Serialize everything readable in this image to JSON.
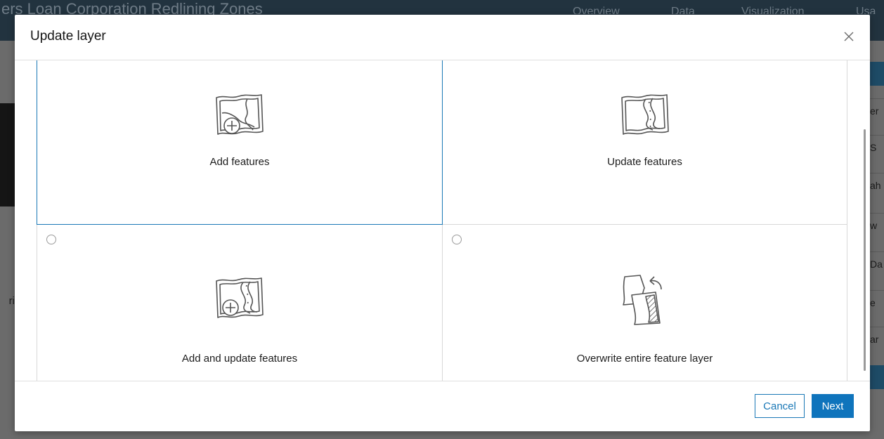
{
  "background": {
    "title": "ers Loan Corporation Redlining Zones",
    "nav": [
      "Overview",
      "Data",
      "Visualization",
      "Usa"
    ],
    "left_text": "ri",
    "right_cells": [
      "er",
      "S",
      "ah",
      "w",
      "Da",
      "e",
      "ar"
    ]
  },
  "modal": {
    "title": "Update layer",
    "close_icon": "close-icon",
    "options": [
      {
        "label": "Add features",
        "icon": "map-add-icon",
        "selected": true
      },
      {
        "label": "Update features",
        "icon": "map-road-icon",
        "selected": false
      },
      {
        "label": "Add and update features",
        "icon": "map-road-add-icon",
        "selected": false
      },
      {
        "label": "Overwrite entire feature layer",
        "icon": "map-overwrite-icon",
        "selected": false
      }
    ],
    "footer": {
      "cancel_label": "Cancel",
      "next_label": "Next"
    }
  },
  "colors": {
    "accent": "#0f74bc",
    "selected_border": "#1a78b6",
    "header_bg": "#22333f"
  }
}
